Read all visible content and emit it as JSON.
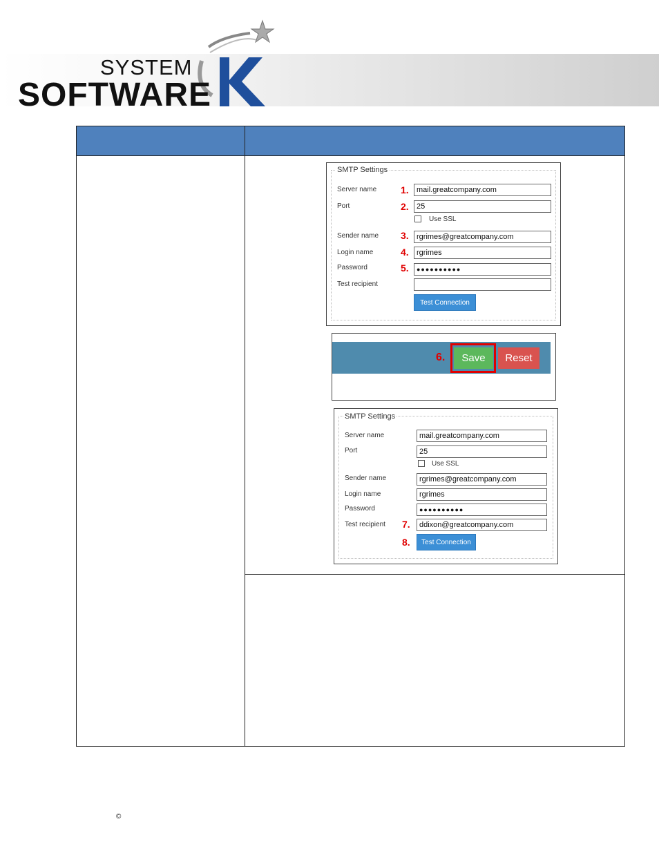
{
  "header": {
    "logo_line1": "SYSTEM",
    "logo_line2": "SOFTWARE",
    "logo_letter": "K"
  },
  "panel1": {
    "legend": "SMTP Settings",
    "labels": {
      "server_name": "Server name",
      "port": "Port",
      "use_ssl": "Use SSL",
      "sender_name": "Sender name",
      "login_name": "Login name",
      "password": "Password",
      "test_recipient": "Test recipient"
    },
    "values": {
      "server_name": "mail.greatcompany.com",
      "port": "25",
      "sender_name": "rgrimes@greatcompany.com",
      "login_name": "rgrimes",
      "password": "●●●●●●●●●●",
      "test_recipient": ""
    },
    "markers": [
      "1.",
      "2.",
      "3.",
      "4.",
      "5."
    ],
    "test_button": "Test Connection"
  },
  "savebar": {
    "marker": "6.",
    "save": "Save",
    "reset": "Reset"
  },
  "panel2": {
    "legend": "SMTP Settings",
    "labels": {
      "server_name": "Server name",
      "port": "Port",
      "use_ssl": "Use SSL",
      "sender_name": "Sender name",
      "login_name": "Login name",
      "password": "Password",
      "test_recipient": "Test recipient"
    },
    "values": {
      "server_name": "mail.greatcompany.com",
      "port": "25",
      "sender_name": "rgrimes@greatcompany.com",
      "login_name": "rgrimes",
      "password": "●●●●●●●●●●",
      "test_recipient": "ddixon@greatcompany.com"
    },
    "markers": [
      "7.",
      "8."
    ],
    "test_button": "Test Connection"
  },
  "footer": {
    "copyright": "©"
  },
  "colors": {
    "table_header": "#4f81bd",
    "marker_red": "#e00000",
    "save_green": "#5cb85c",
    "reset_red": "#d9534f",
    "test_blue": "#3c8fd6"
  }
}
